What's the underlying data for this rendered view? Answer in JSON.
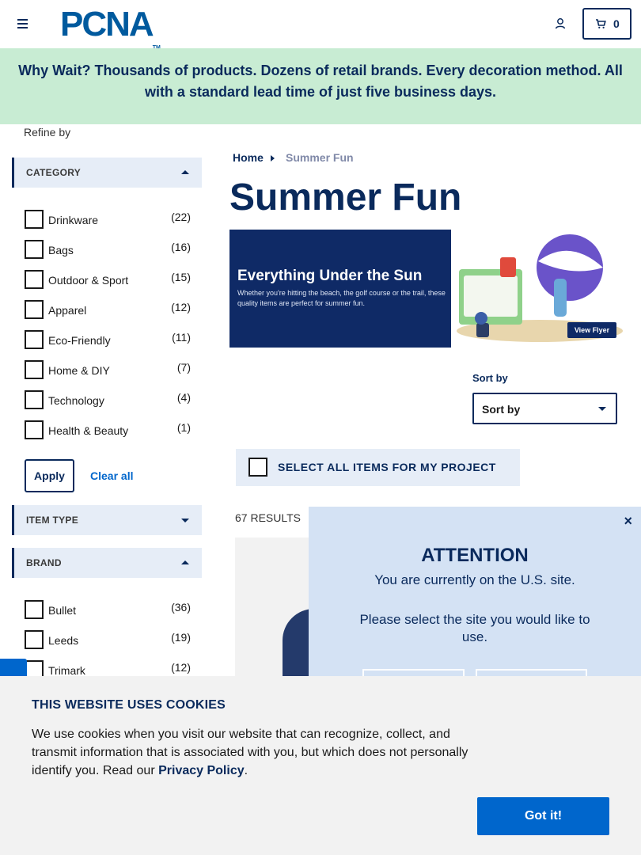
{
  "header": {
    "logo_text": "PCNA",
    "logo_tm": "TM",
    "cart_count": "0"
  },
  "promo": {
    "text": "Why Wait? Thousands of products. Dozens of retail brands. Every decoration method. All with a standard lead time of just five business days."
  },
  "sidebar": {
    "refine_label": "Refine by",
    "category": {
      "title": "CATEGORY",
      "items": [
        {
          "label": "Drinkware",
          "count": "(22)"
        },
        {
          "label": "Bags",
          "count": "(16)"
        },
        {
          "label": "Outdoor & Sport",
          "count": "(15)"
        },
        {
          "label": "Apparel",
          "count": "(12)"
        },
        {
          "label": "Eco-Friendly",
          "count": "(11)"
        },
        {
          "label": "Home & DIY",
          "count": "(7)"
        },
        {
          "label": "Technology",
          "count": "(4)"
        },
        {
          "label": "Health & Beauty",
          "count": "(1)"
        }
      ]
    },
    "apply_label": "Apply",
    "clear_label": "Clear all",
    "item_type_title": "ITEM TYPE",
    "brand": {
      "title": "BRAND",
      "items": [
        {
          "label": "Bullet",
          "count": "(36)"
        },
        {
          "label": "Leeds",
          "count": "(19)"
        },
        {
          "label": "Trimark",
          "count": "(12)"
        }
      ]
    }
  },
  "breadcrumb": {
    "home": "Home",
    "current": "Summer Fun"
  },
  "main": {
    "title": "Summer Fun",
    "hero_title": "Everything Under the Sun",
    "hero_subtitle": "Whether you're hitting the beach, the golf course or the trail, these quality items are perfect for summer fun.",
    "hero_button": "View Flyer",
    "sort_label": "Sort by",
    "sort_value": "Sort by",
    "select_all_label": "SELECT ALL ITEMS FOR MY PROJECT",
    "results_label": "67 RESULTS"
  },
  "attention": {
    "close": "×",
    "title": "ATTENTION",
    "line1": "You are currently on the U.S. site.",
    "line2": "Please select the site you would like to use."
  },
  "cookie": {
    "title": "THIS WEBSITE USES COOKIES",
    "text": "We use cookies when you visit our website that can recognize, collect, and transmit information that is associated with you, but which does not personally identify you. Read our ",
    "link": "Privacy Policy",
    "text_end": ".",
    "button": "Got it!"
  },
  "colors": {
    "navy": "#0a2a5c",
    "brand_blue": "#005a9e",
    "promo_bg": "#c8ecd3",
    "facet_bg": "#e6edf7",
    "attention_bg": "#d4e2f4",
    "button_blue": "#0066cc"
  }
}
